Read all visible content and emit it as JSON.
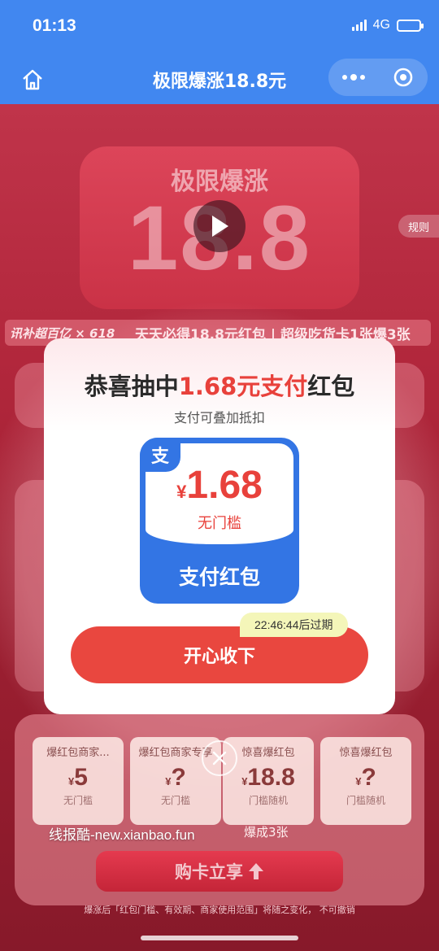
{
  "status": {
    "time": "01:13",
    "network": "4G"
  },
  "nav": {
    "title": "极限爆涨18.8元"
  },
  "background": {
    "banner_small_title": "极限爆涨",
    "banner_big_number": "18.8",
    "rules_label": "规则",
    "brand_mark": "讯补超百亿 × 618",
    "slogan": "天天必得18.8元红包 | 超级吃货卡1张爆3张",
    "coupons": [
      {
        "title": "爆红包商家...",
        "currency": "¥",
        "amount": "5",
        "sub": "无门槛"
      },
      {
        "title": "爆红包商家专享",
        "currency": "¥",
        "amount": "?",
        "sub": "无门槛"
      },
      {
        "title": "惊喜爆红包",
        "currency": "¥",
        "amount": "18.8",
        "sub": "门槛随机"
      },
      {
        "title": "惊喜爆红包",
        "currency": "¥",
        "amount": "?",
        "sub": "门槛随机"
      }
    ],
    "watermark": "线报酷-new.xianbao.fun",
    "bonus_text": "爆成3张",
    "buy_button": "购卡立享",
    "footnote": "爆涨后「红包门槛、有效期、商家使用范围」将随之变化，          不可撤销"
  },
  "modal": {
    "title_prefix": "恭喜抽中",
    "title_highlight": "1.68元支付",
    "title_suffix": "红包",
    "subtitle": "支付可叠加抵扣",
    "packet": {
      "logo": "支",
      "currency": "¥",
      "amount": "1.68",
      "threshold": "无门槛",
      "label": "支付红包"
    },
    "expire_tag": "22:46:44后过期",
    "accept_button": "开心收下"
  },
  "colors": {
    "nav_blue": "#4187f0",
    "accent_red": "#e8413b",
    "packet_blue": "#3375e4",
    "expire_yellow": "#f4f6b9"
  }
}
